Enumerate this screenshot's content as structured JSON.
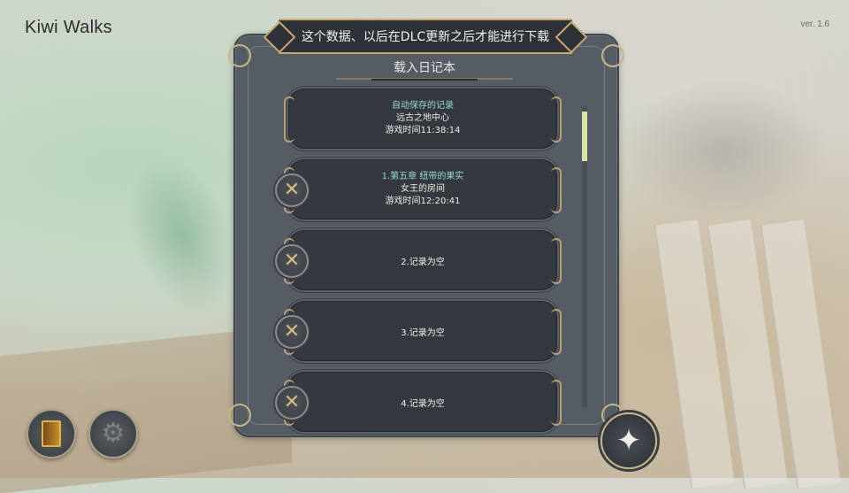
{
  "app": {
    "logo": "Kiwi Walks",
    "version": "ver. 1.6"
  },
  "notice": {
    "text": "这个数据、以后在DLC更新之后才能进行下载"
  },
  "panel": {
    "title": "载入日记本"
  },
  "slots": [
    {
      "line1": "自动保存的记录",
      "line2": "远古之地中心",
      "line3": "游戏时间11:38:14"
    },
    {
      "line1": "1.第五章 纽带的果实",
      "line2": "女王的房间",
      "line3": "游戏时间12:20:41"
    },
    {
      "label": "2.记录为空"
    },
    {
      "label": "3.记录为空"
    },
    {
      "label": "4.记录为空"
    }
  ],
  "icons": {
    "delete": "close-icon",
    "diary": "book-icon",
    "settings": "gear-icon",
    "confirm": "star-icon"
  },
  "colors": {
    "accent": "#9ad7d9",
    "gold": "#caa870",
    "scroll_thumb": "#d8e6a8"
  }
}
